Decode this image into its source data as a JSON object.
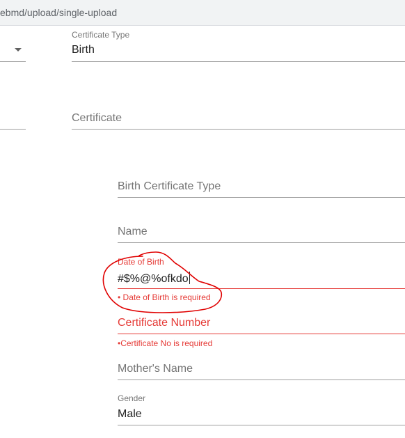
{
  "browser": {
    "url": "ebmd/upload/single-upload"
  },
  "form": {
    "left_column": {
      "dropdown_icon": "chevron-down-icon"
    },
    "certificate_type": {
      "label": "Certificate Type",
      "value": "Birth"
    },
    "certificate": {
      "placeholder": "Certificate"
    },
    "birth_certificate_type": {
      "placeholder": "Birth Certificate Type"
    },
    "name": {
      "placeholder": "Name"
    },
    "date_of_birth": {
      "label": "Date of Birth",
      "value": "#$%@%ofkdo",
      "error": "• Date of Birth is required"
    },
    "certificate_number": {
      "placeholder": "Certificate Number",
      "error": "•Certificate No is required"
    },
    "mothers_name": {
      "placeholder": "Mother's Name"
    },
    "gender": {
      "label": "Gender",
      "value": "Male"
    }
  },
  "colors": {
    "error": "#e53935",
    "annotation": "#e00000",
    "underline": "#9e9e9e"
  }
}
